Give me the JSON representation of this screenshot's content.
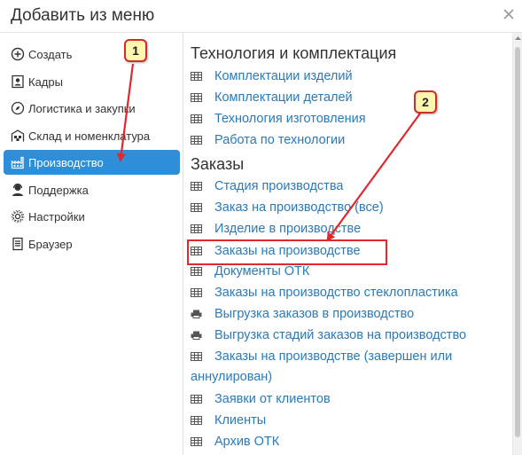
{
  "header": {
    "title": "Добавить из меню"
  },
  "sidebar": {
    "items": [
      {
        "label": "Создать",
        "icon": "plus-circle-icon"
      },
      {
        "label": "Кадры",
        "icon": "person-card-icon"
      },
      {
        "label": "Логистика и закупки",
        "icon": "compass-icon"
      },
      {
        "label": "Склад и номенклатура",
        "icon": "warehouse-icon"
      },
      {
        "label": "Производство",
        "icon": "factory-icon",
        "active": true
      },
      {
        "label": "Поддержка",
        "icon": "support-user-icon"
      },
      {
        "label": "Настройки",
        "icon": "gear-icon"
      },
      {
        "label": "Браузер",
        "icon": "document-icon"
      }
    ]
  },
  "content": {
    "section1_title": "Технология и комплектация",
    "section1_items": [
      "Комплектации изделий",
      "Комплектации деталей",
      "Технология изготовления",
      "Работа по технологии"
    ],
    "section2_title": "Заказы",
    "section2_items": [
      "Стадия производства",
      "Заказ на производство (все)",
      "Изделие в производстве",
      "Заказы на производстве",
      "Документы ОТК",
      "Заказы на производство стеклопластика",
      "Выгрузка заказов в производство",
      "Выгрузка стадий заказов на производство",
      "Заказы на производстве (завершен или",
      "аннулирован)",
      "Заявки от клиентов",
      "Клиенты",
      "Архив ОТК"
    ]
  },
  "annotations": {
    "callout1": "1",
    "callout2": "2"
  },
  "colors": {
    "accent": "#2e8fd8",
    "link": "#2a7ab8",
    "annotation_red": "#e0282f",
    "callout_bg": "#fff6b0"
  }
}
